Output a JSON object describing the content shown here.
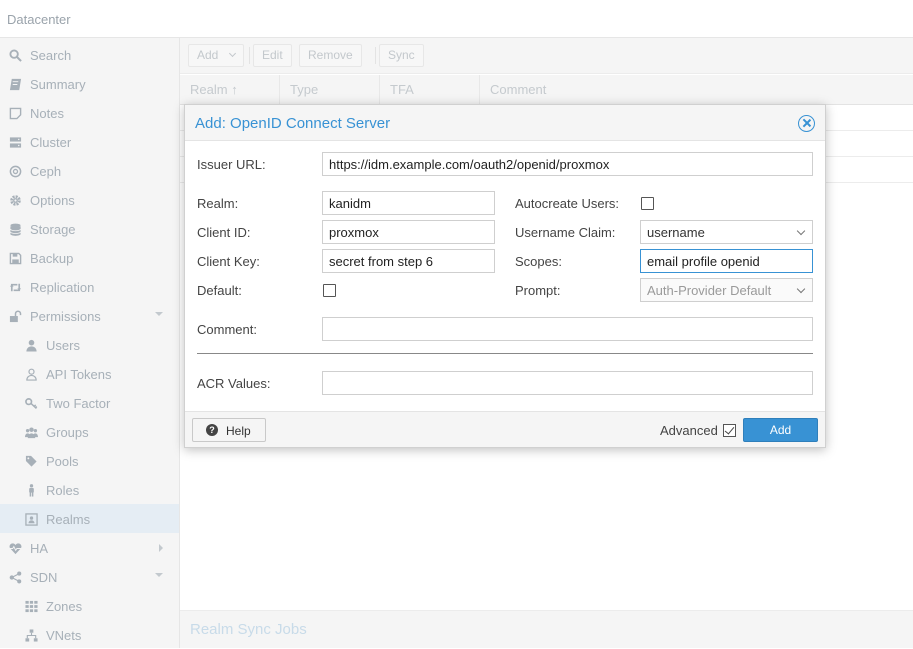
{
  "topbar": {
    "title": "Datacenter"
  },
  "sidebar": {
    "items": [
      {
        "label": "Search",
        "icon": "search-icon"
      },
      {
        "label": "Summary",
        "icon": "book-icon"
      },
      {
        "label": "Notes",
        "icon": "notes-icon"
      },
      {
        "label": "Cluster",
        "icon": "server-icon"
      },
      {
        "label": "Ceph",
        "icon": "ceph-icon"
      },
      {
        "label": "Options",
        "icon": "gear-icon"
      },
      {
        "label": "Storage",
        "icon": "database-icon"
      },
      {
        "label": "Backup",
        "icon": "floppy-icon"
      },
      {
        "label": "Replication",
        "icon": "retweet-icon"
      },
      {
        "label": "Permissions",
        "icon": "unlock-icon"
      },
      {
        "label": "Users",
        "icon": "user-icon"
      },
      {
        "label": "API Tokens",
        "icon": "user-outline-icon"
      },
      {
        "label": "Two Factor",
        "icon": "key-icon"
      },
      {
        "label": "Groups",
        "icon": "users-icon"
      },
      {
        "label": "Pools",
        "icon": "tags-icon"
      },
      {
        "label": "Roles",
        "icon": "male-icon"
      },
      {
        "label": "Realms",
        "icon": "id-card-icon"
      },
      {
        "label": "HA",
        "icon": "heartbeat-icon"
      },
      {
        "label": "SDN",
        "icon": "sdn-icon"
      },
      {
        "label": "Zones",
        "icon": "grid-icon"
      },
      {
        "label": "VNets",
        "icon": "network-icon"
      }
    ]
  },
  "toolbar": {
    "add": "Add",
    "edit": "Edit",
    "remove": "Remove",
    "sync": "Sync"
  },
  "grid": {
    "columns": [
      "Realm",
      "Type",
      "TFA",
      "Comment"
    ]
  },
  "bottom_panel": {
    "title": "Realm Sync Jobs"
  },
  "dialog": {
    "title": "Add: OpenID Connect Server",
    "issuer_url_label": "Issuer URL:",
    "issuer_url_value": "https://idm.example.com/oauth2/openid/proxmox",
    "realm_label": "Realm:",
    "realm_value": "kanidm",
    "client_id_label": "Client ID:",
    "client_id_value": "proxmox",
    "client_key_label": "Client Key:",
    "client_key_value": "secret from step 6",
    "default_label": "Default:",
    "autocreate_label": "Autocreate Users:",
    "username_claim_label": "Username Claim:",
    "username_claim_value": "username",
    "scopes_label": "Scopes:",
    "scopes_value": "email profile openid",
    "prompt_label": "Prompt:",
    "prompt_value": "Auth-Provider Default",
    "comment_label": "Comment:",
    "comment_value": "",
    "acr_label": "ACR Values:",
    "acr_value": "",
    "help": "Help",
    "advanced": "Advanced",
    "add": "Add"
  },
  "colors": {
    "accent": "#3892d4",
    "sidebar_text": "#a7b0b8"
  }
}
